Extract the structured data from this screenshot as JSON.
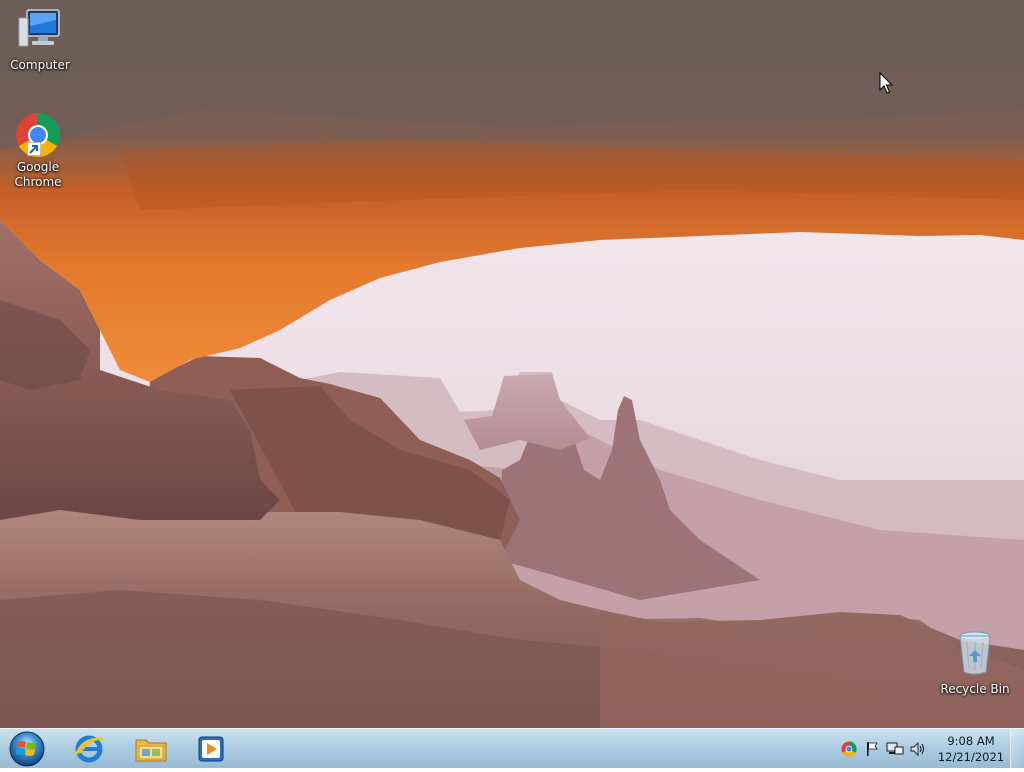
{
  "desktop": {
    "icons": [
      {
        "label": "Computer",
        "icon": "computer-icon"
      },
      {
        "label": "Google Chrome",
        "icon": "chrome-icon"
      },
      {
        "label": "Recycle Bin",
        "icon": "recycle-bin-icon"
      }
    ]
  },
  "taskbar": {
    "start": {
      "icon": "windows-start-orb-icon"
    },
    "pinned": [
      {
        "icon": "internet-explorer-icon"
      },
      {
        "icon": "file-explorer-icon"
      },
      {
        "icon": "media-player-icon"
      }
    ],
    "tray": {
      "icons": [
        "chrome-tray-icon",
        "action-center-flag-icon",
        "network-icon",
        "volume-icon"
      ],
      "time": "9:08 AM",
      "date": "12/21/2021"
    }
  },
  "colors": {
    "taskbar": "#a9c9e0",
    "arch_orange": "#e07a2a",
    "rock": "#8a5a50",
    "sky": "#f3e9ee"
  }
}
